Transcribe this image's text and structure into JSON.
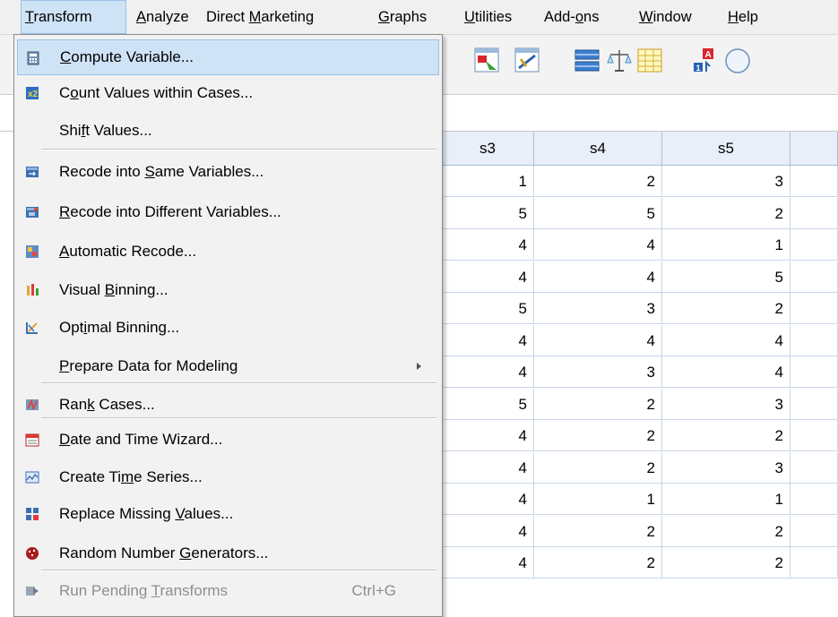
{
  "menubar": {
    "items": [
      {
        "pre": "",
        "ul": "T",
        "post": "ransform"
      },
      {
        "pre": "",
        "ul": "A",
        "post": "nalyze"
      },
      {
        "pre": "Direct ",
        "ul": "M",
        "post": "arketing"
      },
      {
        "pre": "",
        "ul": "G",
        "post": "raphs"
      },
      {
        "pre": "",
        "ul": "U",
        "post": "tilities"
      },
      {
        "pre": "Add-",
        "ul": "o",
        "post": "ns"
      },
      {
        "pre": "",
        "ul": "W",
        "post": "indow"
      },
      {
        "pre": "",
        "ul": "H",
        "post": "elp"
      }
    ]
  },
  "menu": {
    "items": [
      {
        "pre": "",
        "ul": "C",
        "post": "ompute Variable...",
        "icon": "calculator-icon"
      },
      {
        "pre": "C",
        "ul": "o",
        "post": "unt Values within Cases...",
        "icon": "count-values-icon"
      },
      {
        "pre": "Shi",
        "ul": "f",
        "post": "t Values...",
        "icon": ""
      },
      {
        "pre": "Recode into ",
        "ul": "S",
        "post": "ame Variables...",
        "icon": "recode-icon"
      },
      {
        "pre": "",
        "ul": "R",
        "post": "ecode into Different Variables...",
        "icon": "recode-different-icon"
      },
      {
        "pre": "",
        "ul": "A",
        "post": "utomatic Recode...",
        "icon": "automatic-recode-icon"
      },
      {
        "pre": "Visual ",
        "ul": "B",
        "post": "inning...",
        "icon": "visual-binning-icon"
      },
      {
        "pre": "Opt",
        "ul": "i",
        "post": "mal Binning...",
        "icon": "optimal-binning-icon"
      },
      {
        "pre": "",
        "ul": "P",
        "post": "repare Data for Modeling",
        "icon": ""
      },
      {
        "pre": "Ran",
        "ul": "k",
        "post": " Cases...",
        "icon": "rank-cases-icon"
      },
      {
        "pre": "",
        "ul": "D",
        "post": "ate and Time Wizard...",
        "icon": "date-time-icon"
      },
      {
        "pre": "Create Ti",
        "ul": "m",
        "post": "e Series...",
        "icon": "time-series-icon"
      },
      {
        "pre": "Replace Missing ",
        "ul": "V",
        "post": "alues...",
        "icon": "replace-missing-icon"
      },
      {
        "pre": "Random Number ",
        "ul": "G",
        "post": "enerators...",
        "icon": "dice-icon"
      },
      {
        "pre": "Run Pending ",
        "ul": "T",
        "post": "ransforms",
        "icon": "run-pending-icon",
        "shortcut": "Ctrl+G"
      }
    ]
  },
  "grid": {
    "columns": [
      "s3",
      "s4",
      "s5"
    ],
    "rows": [
      [
        "1",
        "2",
        "3"
      ],
      [
        "5",
        "5",
        "2"
      ],
      [
        "4",
        "4",
        "1"
      ],
      [
        "4",
        "4",
        "5"
      ],
      [
        "5",
        "3",
        "2"
      ],
      [
        "4",
        "4",
        "4"
      ],
      [
        "4",
        "3",
        "4"
      ],
      [
        "5",
        "2",
        "3"
      ],
      [
        "4",
        "2",
        "2"
      ],
      [
        "4",
        "2",
        "3"
      ],
      [
        "4",
        "1",
        "1"
      ],
      [
        "4",
        "2",
        "2"
      ],
      [
        "4",
        "2",
        "2"
      ]
    ]
  },
  "colors": {
    "highlight": "#cfe3f6",
    "grid_header": "#e8eff8"
  }
}
